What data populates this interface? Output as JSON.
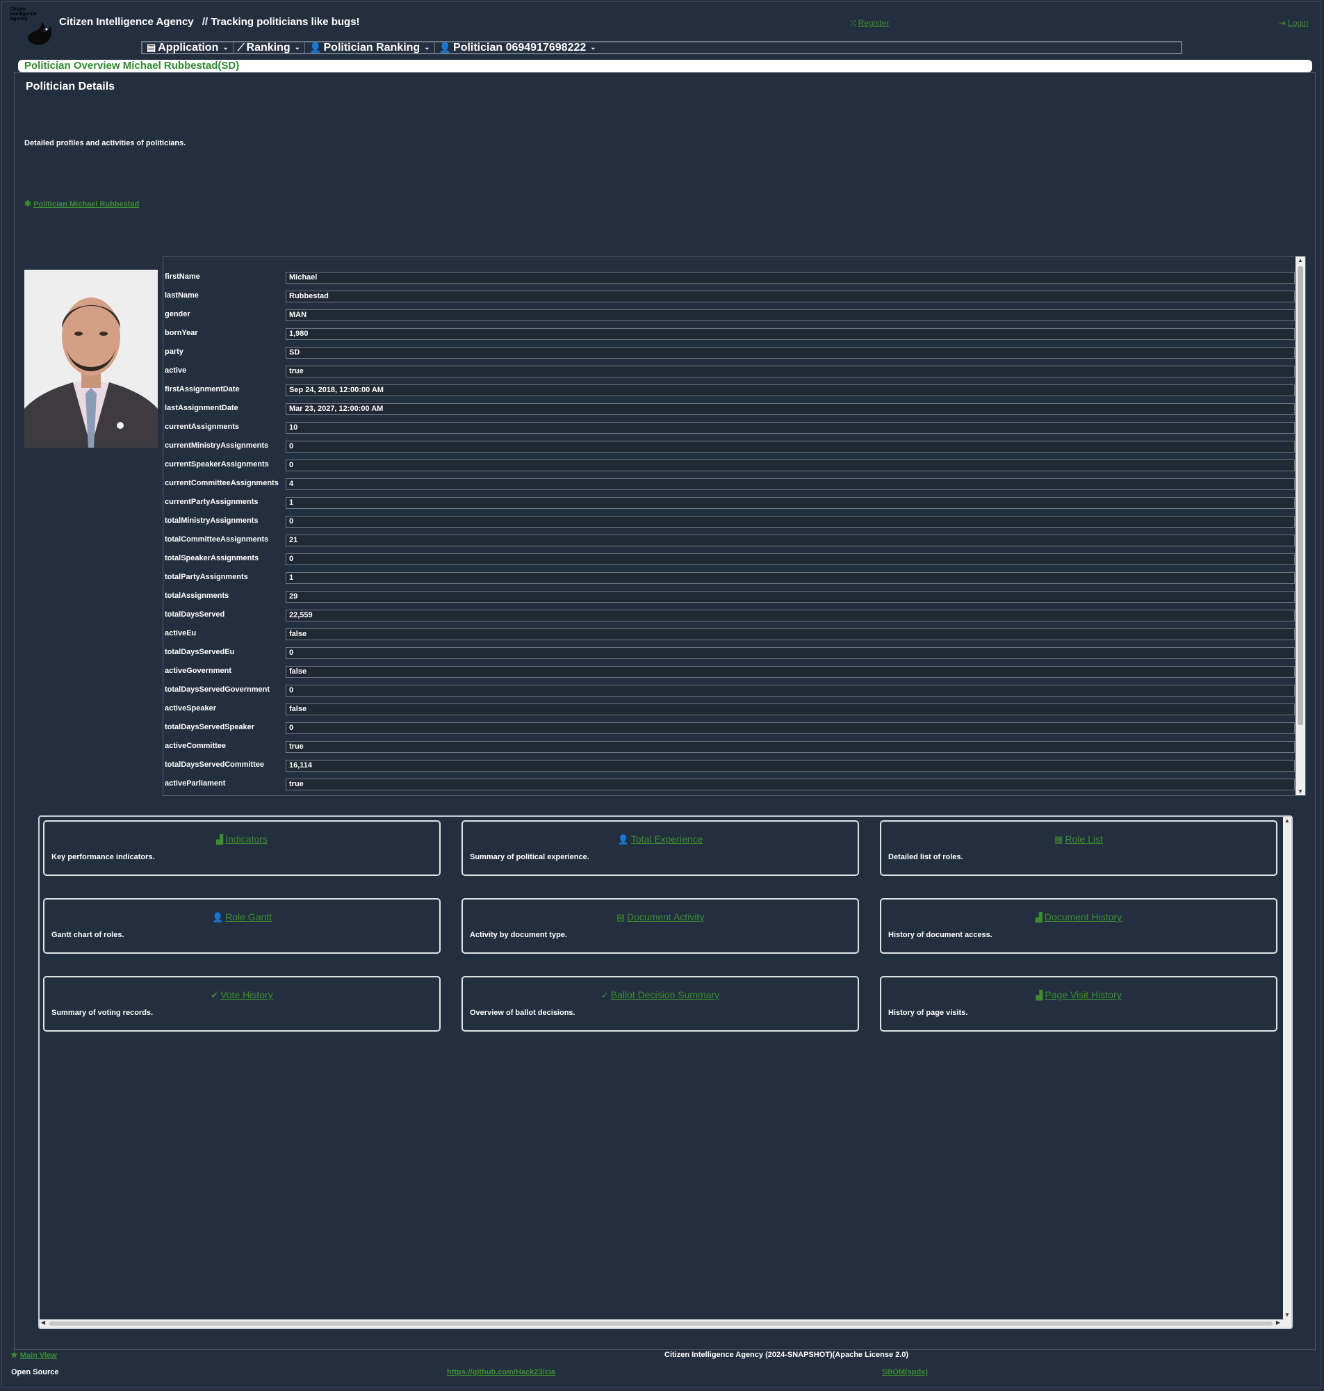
{
  "header": {
    "logo_text": "Citizen Intelligence Agency",
    "app_name": "Citizen Intelligence Agency",
    "tagline": "// Tracking politicians like bugs!",
    "register": "Register",
    "login": "Login"
  },
  "menu": [
    {
      "label": "Application",
      "icon": "file-icon"
    },
    {
      "label": "Ranking",
      "icon": "line-chart-icon"
    },
    {
      "label": "Politician Ranking",
      "icon": "user-icon"
    },
    {
      "label": "Politician 0694917698222",
      "icon": "user-icon"
    }
  ],
  "page": {
    "overview_title": "Politician Overview Michael Rubbestad(SD)",
    "details_title": "Politician Details",
    "details_desc": "Detailed profiles and activities of politicians.",
    "politician_link": "Politician Michael Rubbestad"
  },
  "details": [
    {
      "label": "firstName",
      "value": "Michael"
    },
    {
      "label": "lastName",
      "value": "Rubbestad"
    },
    {
      "label": "gender",
      "value": "MAN"
    },
    {
      "label": "bornYear",
      "value": "1,980"
    },
    {
      "label": "party",
      "value": "SD"
    },
    {
      "label": "active",
      "value": "true"
    },
    {
      "label": "firstAssignmentDate",
      "value": "Sep 24, 2018, 12:00:00 AM"
    },
    {
      "label": "lastAssignmentDate",
      "value": "Mar 23, 2027, 12:00:00 AM"
    },
    {
      "label": "currentAssignments",
      "value": "10"
    },
    {
      "label": "currentMinistryAssignments",
      "value": "0"
    },
    {
      "label": "currentSpeakerAssignments",
      "value": "0"
    },
    {
      "label": "currentCommitteeAssignments",
      "value": "4"
    },
    {
      "label": "currentPartyAssignments",
      "value": "1"
    },
    {
      "label": "totalMinistryAssignments",
      "value": "0"
    },
    {
      "label": "totalCommitteeAssignments",
      "value": "21"
    },
    {
      "label": "totalSpeakerAssignments",
      "value": "0"
    },
    {
      "label": "totalPartyAssignments",
      "value": "1"
    },
    {
      "label": "totalAssignments",
      "value": "29"
    },
    {
      "label": "totalDaysServed",
      "value": "22,559"
    },
    {
      "label": "activeEu",
      "value": "false"
    },
    {
      "label": "totalDaysServedEu",
      "value": "0"
    },
    {
      "label": "activeGovernment",
      "value": "false"
    },
    {
      "label": "totalDaysServedGovernment",
      "value": "0"
    },
    {
      "label": "activeSpeaker",
      "value": "false"
    },
    {
      "label": "totalDaysServedSpeaker",
      "value": "0"
    },
    {
      "label": "activeCommittee",
      "value": "true"
    },
    {
      "label": "totalDaysServedCommittee",
      "value": "16,114"
    },
    {
      "label": "activeParliament",
      "value": "true"
    }
  ],
  "cards": [
    {
      "title": "Indicators",
      "desc": "Key performance indicators.",
      "icon": "chart-icon"
    },
    {
      "title": "Total Experience",
      "desc": "Summary of political experience.",
      "icon": "user-icon"
    },
    {
      "title": "Role List",
      "desc": "Detailed list of roles.",
      "icon": "table-icon"
    },
    {
      "title": "Role Gantt",
      "desc": "Gantt chart of roles.",
      "icon": "user-icon"
    },
    {
      "title": "Document Activity",
      "desc": "Activity by document type.",
      "icon": "file-icon"
    },
    {
      "title": "Document History",
      "desc": "History of document access.",
      "icon": "chart-icon"
    },
    {
      "title": "Vote History",
      "desc": "Summary of voting records.",
      "icon": "check-circle-icon"
    },
    {
      "title": "Ballot Decision Summary",
      "desc": "Overview of ballot decisions.",
      "icon": "check-icon"
    },
    {
      "title": "Page Visit History",
      "desc": "History of page visits.",
      "icon": "chart-icon"
    }
  ],
  "footer": {
    "main_view": "Main View",
    "license": "Citizen Intelligence Agency (2024-SNAPSHOT)(Apache License 2.0)",
    "open_source": "Open Source",
    "github": "https://github.com/Hack23/cia",
    "sbom": "SBOM(spdx)"
  }
}
